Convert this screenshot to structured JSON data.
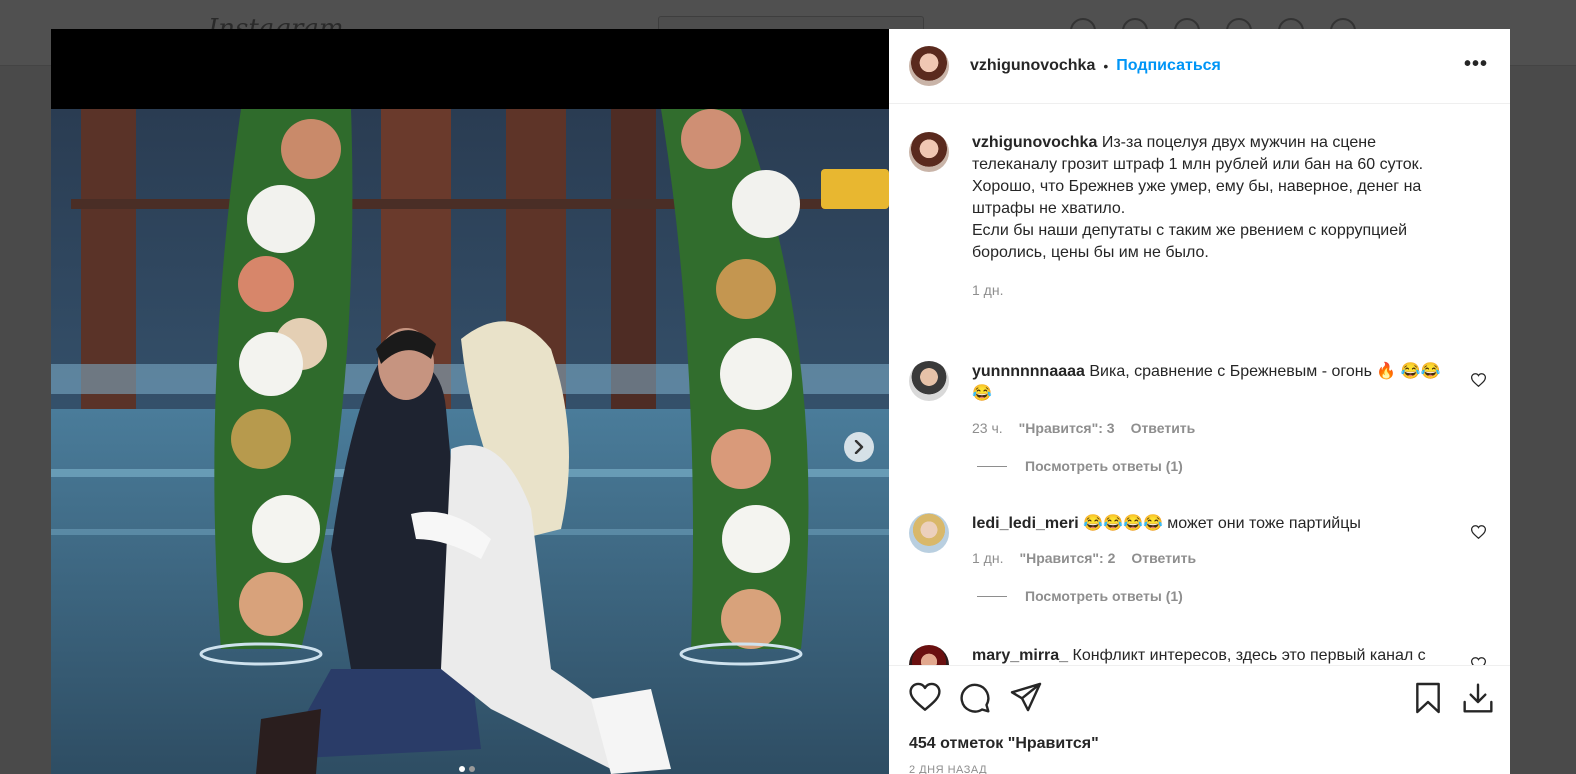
{
  "background_page": {
    "logo": "Instagram"
  },
  "post": {
    "author": "vzhigunovochka",
    "follow_label": "Подписаться",
    "separator": "•",
    "more_label": "•••",
    "caption": {
      "user": "vzhigunovochka",
      "text_line1": "Из-за поцелуя двух мужчин на сцене телеканалу грозит штраф 1 млн рублей или бан на 60 суток. Хорошо, что Брежнев уже умер, ему бы, наверное, денег на штрафы не хватило.",
      "text_line2": "Если бы наши депутаты с таким же рвением с коррупцией боролись, цены бы им не было.",
      "time": "1 дн."
    },
    "comments": [
      {
        "user": "yunnnnnnaaaa",
        "text": "Вика, сравнение с Брежневым - огонь 🔥 😂😂😂",
        "time": "23 ч.",
        "likes": "\"Нравится\": 3",
        "reply": "Ответить",
        "view_replies": "Посмотреть ответы (1)"
      },
      {
        "user": "ledi_ledi_meri",
        "text": "😂😂😂😂 может они тоже партийцы",
        "time": "1 дн.",
        "likes": "\"Нравится\": 2",
        "reply": "Ответить",
        "view_replies": "Посмотреть ответы (1)"
      },
      {
        "user": "mary_mirra_",
        "text": "Конфликт интересов, здесь это первый канал с КВН и ТНТ с Игрой :) таким образом устраняют неугодных."
      }
    ],
    "likes_count": "454 отметок \"Нравится\"",
    "date_peek": "2 ДНЯ НАЗАД",
    "carousel": {
      "slides": 2,
      "current": 1
    }
  },
  "colors": {
    "accent": "#0095f6",
    "text": "#262626",
    "muted": "#8e8e8e",
    "overlay": "#4a4a4a"
  },
  "icons": [
    "heart-icon",
    "comment-icon",
    "share-icon",
    "bookmark-icon",
    "download-icon",
    "chevron-right-icon",
    "more-icon"
  ]
}
